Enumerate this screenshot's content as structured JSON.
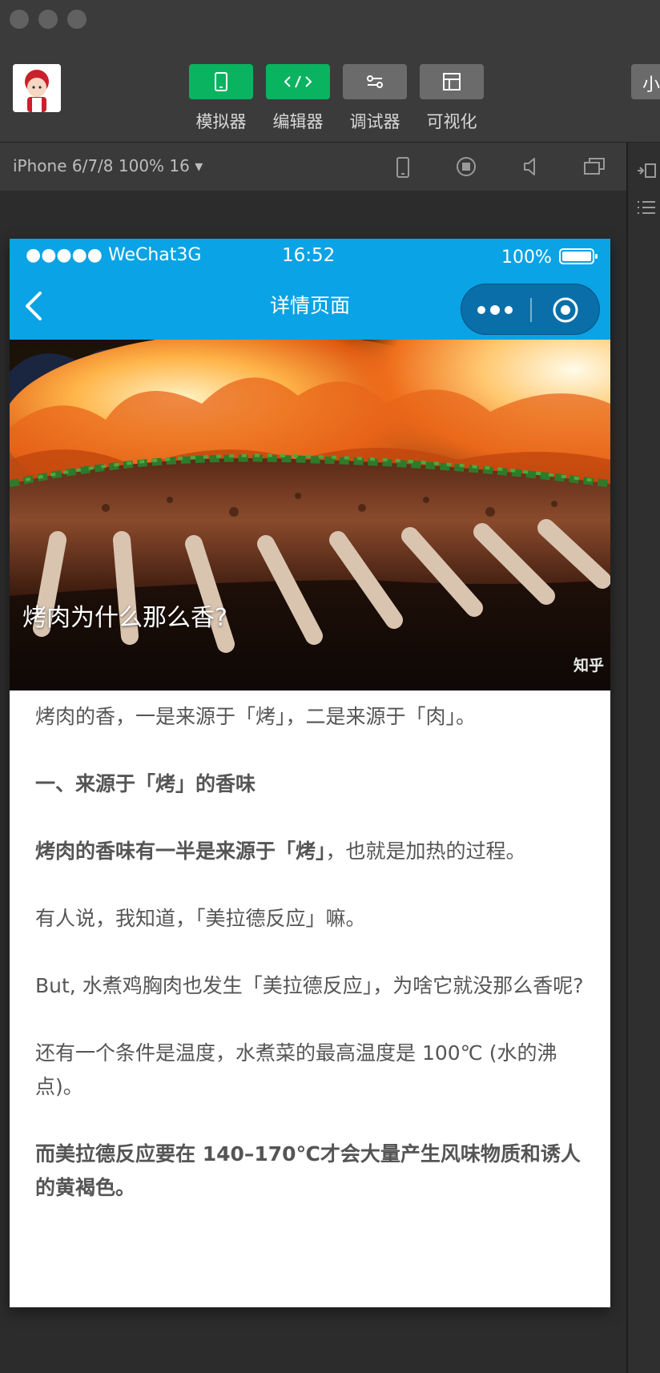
{
  "toolbar": {
    "tools": [
      {
        "label": "模拟器",
        "icon": "phone-icon"
      },
      {
        "label": "编辑器",
        "icon": "code-icon"
      },
      {
        "label": "调试器",
        "icon": "debug-icon"
      },
      {
        "label": "可视化",
        "icon": "layout-icon"
      }
    ],
    "right_button": "小"
  },
  "device_bar": {
    "device": "iPhone 6/7/8 100% 16 ▾"
  },
  "phone": {
    "status": {
      "carrier": "●●●●● WeChat3G",
      "time": "16:52",
      "battery": "100%"
    },
    "nav": {
      "title": "详情页面"
    },
    "hero": {
      "title": "烤肉为什么那么香?",
      "watermark": "知乎"
    },
    "paragraphs": {
      "p1": "烤肉的香，一是来源于「烤」，二是来源于「肉」。",
      "p2": "一、来源于「烤」的香味",
      "p3_bold": "烤肉的香味有一半是来源于「烤」",
      "p3_rest": "，也就是加热的过程。",
      "p4": "有人说，我知道，「美拉德反应」嘛。",
      "p5": "But, 水煮鸡胸肉也发生「美拉德反应」，为啥它就没那么香呢?",
      "p6": "还有一个条件是温度，水煮菜的最高温度是 100℃ (水的沸点)。",
      "p7": "而美拉德反应要在 140–170℃才会大量产生风味物质和诱人的黄褐色。"
    }
  },
  "colors": {
    "wechat_green": "#09b360",
    "nav_blue": "#0aa3e5",
    "capsule_blue": "#0a6fa8",
    "body_text": "#555555"
  }
}
